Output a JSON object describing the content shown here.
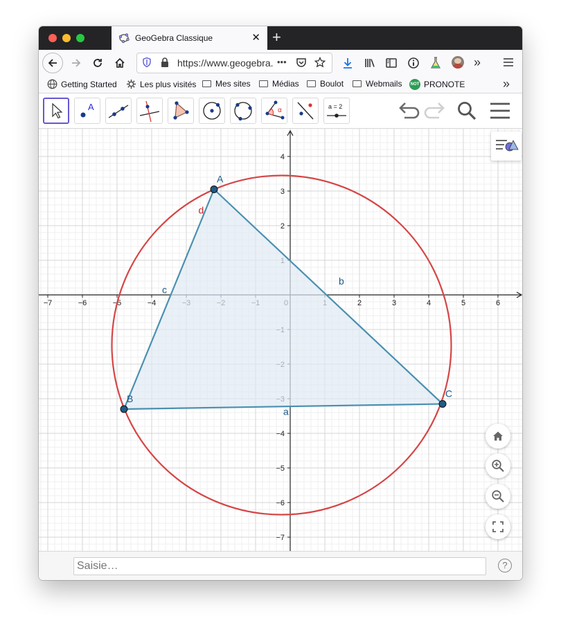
{
  "tab": {
    "title": "GeoGebra Classique",
    "close": "✕",
    "new_tab": "+"
  },
  "navbar": {
    "url": "https://www.geogebra.org/classic",
    "more": "•••"
  },
  "bookmarks": [
    {
      "label": "Getting Started",
      "icon": "globe-icon"
    },
    {
      "label": "Les plus visités",
      "icon": "gear-icon"
    },
    {
      "label": "Mes sites",
      "icon": "folder-icon"
    },
    {
      "label": "Médias",
      "icon": "folder-icon"
    },
    {
      "label": "Boulot",
      "icon": "folder-icon"
    },
    {
      "label": "Webmails",
      "icon": "folder-icon"
    },
    {
      "label": "PRONOTE",
      "icon": "pronote-icon",
      "badge": "NOT"
    }
  ],
  "toolbar": {
    "tools": [
      "move",
      "point",
      "line",
      "perpendicular-line",
      "polygon",
      "circle-center-point",
      "circle-three-points",
      "angle",
      "reflect",
      "slider"
    ],
    "point_tool_label": "A",
    "slider_tool_label": "a = 2",
    "angle_tool_label": "α"
  },
  "graphics": {
    "x_ticks": [
      "−7",
      "−6",
      "−5",
      "−4",
      "−3",
      "−2",
      "−1",
      "0",
      "1",
      "2",
      "3",
      "4",
      "5",
      "6"
    ],
    "y_ticks": [
      "4",
      "3",
      "2",
      "1",
      "−1",
      "−2",
      "−3",
      "−4",
      "−5",
      "−6",
      "−7"
    ],
    "points": [
      {
        "name": "A",
        "x": -2.2,
        "y": 3.05
      },
      {
        "name": "B",
        "x": -4.8,
        "y": -3.3
      },
      {
        "name": "C",
        "x": 4.4,
        "y": -3.15
      }
    ],
    "segments": [
      {
        "name": "a",
        "from": "B",
        "to": "C"
      },
      {
        "name": "b",
        "from": "A",
        "to": "C"
      },
      {
        "name": "c",
        "from": "A",
        "to": "B"
      }
    ],
    "circle": {
      "name": "d",
      "center_x": -0.25,
      "center_y": -1.45,
      "radius": 4.9
    },
    "colors": {
      "triangle": "#4a90b0",
      "triangle_fill": "#dfe9f3",
      "circle": "#d64545",
      "point_fill": "#1f5b85"
    }
  },
  "input": {
    "placeholder": "Saisie…"
  },
  "help": "?"
}
